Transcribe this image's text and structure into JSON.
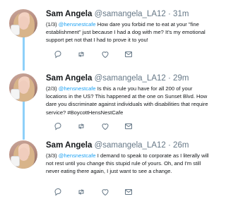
{
  "tweets": [
    {
      "name": "Sam Angela",
      "handle": "@samangela_LA12",
      "dot": "·",
      "time": "31m",
      "count": "(1/3)",
      "mention": "@hensnestcafe",
      "text": "How dare you forbid me to eat at your \"fine establishment\" just because I had a dog with me? It's my emotional support pet not that I had to prove it to you!"
    },
    {
      "name": "Sam Angela",
      "handle": "@samangela_LA12",
      "dot": "·",
      "time": "29m",
      "count": "(2/3)",
      "mention": "@hensnestcafe",
      "text": "Is this a rule you have for all 200 of your locations in the US? This happened at the one on Sunset Blvd. How dare you discriminate against individuals with disabilities that require service? #BoycottHensNestCafe"
    },
    {
      "name": "Sam Angela",
      "handle": "@samangela_LA12",
      "dot": "·",
      "time": "26m",
      "count": "(3/3)",
      "mention": "@hensnestcafe",
      "text": "I demand to speak to corporate as I literally will not rest until you change this stupid rule of yours. Oh, and I'm still never eating there again, I just want to see a change."
    }
  ],
  "icons": {
    "reply": "reply-icon",
    "retweet": "retweet-icon",
    "like": "heart-icon",
    "message": "envelope-icon"
  },
  "colors": {
    "accent": "#1da1f2",
    "thread_line": "#8ed0f9",
    "muted": "#657786",
    "text": "#14171a"
  }
}
